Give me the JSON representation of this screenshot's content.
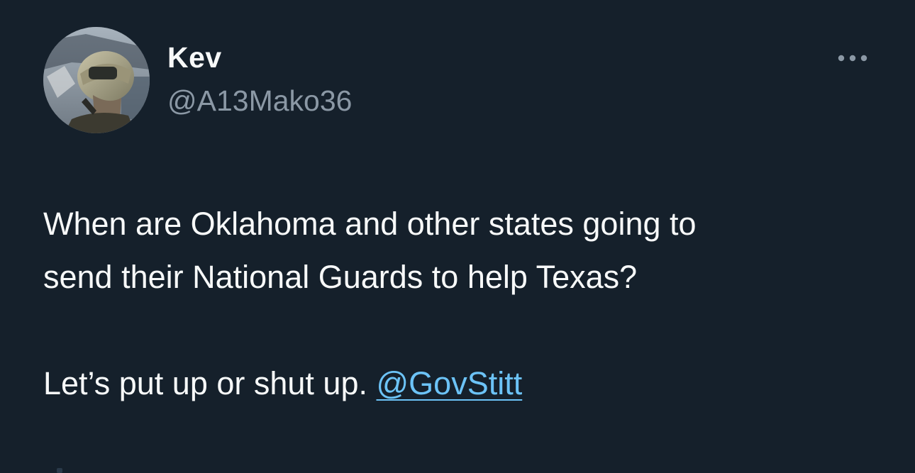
{
  "author": {
    "display_name": "Kev",
    "handle": "@A13Mako36",
    "avatar_icon": "pilot-helmet-avatar"
  },
  "more_icon": "ellipsis-icon",
  "tweet": {
    "line1": "When are Oklahoma and other states going to",
    "line2": "send their National Guards to help Texas?",
    "line3_prefix": "Let’s put up or shut up. ",
    "mention": "@GovStitt"
  },
  "colors": {
    "background": "#15202b",
    "primary_text": "#f7f9f9",
    "secondary_text": "#8b98a5",
    "link": "#6cc3f7"
  }
}
